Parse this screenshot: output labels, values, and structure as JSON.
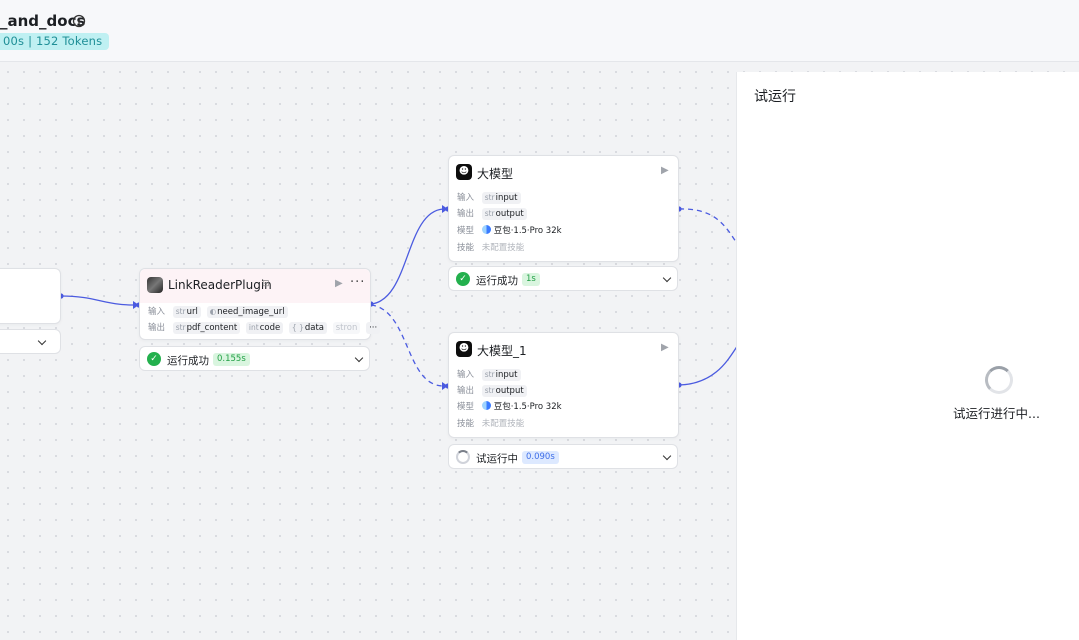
{
  "header": {
    "title": "_and_docs",
    "stats": "00s | 152 Tokens"
  },
  "nodes": {
    "plugin": {
      "title": "LinkReaderPlugin",
      "input_label": "输入",
      "output_label": "输出",
      "inputs": [
        {
          "type": "str",
          "name": "url"
        },
        {
          "type": "◐",
          "name": "need_image_url"
        }
      ],
      "outputs": [
        {
          "type": "str",
          "name": "pdf_content"
        },
        {
          "type": "int",
          "name": "code"
        },
        {
          "type": "{ }",
          "name": "data"
        },
        {
          "type": "",
          "name": "stron"
        }
      ],
      "more": "···",
      "status": {
        "text": "运行成功",
        "duration": "0.155s"
      }
    },
    "llm": {
      "title": "大模型",
      "input_label": "输入",
      "output_label": "输出",
      "model_label": "模型",
      "skill_label": "技能",
      "input": {
        "type": "str",
        "name": "input"
      },
      "output": {
        "type": "str",
        "name": "output"
      },
      "model": "豆包·1.5·Pro 32k",
      "skill": "未配置技能",
      "status": {
        "text": "运行成功",
        "duration": "1s"
      }
    },
    "llm1": {
      "title": "大模型_1",
      "input_label": "输入",
      "output_label": "输出",
      "model_label": "模型",
      "skill_label": "技能",
      "input": {
        "type": "str",
        "name": "input"
      },
      "output": {
        "type": "str",
        "name": "output"
      },
      "model": "豆包·1.5·Pro 32k",
      "skill": "未配置技能",
      "status": {
        "text": "试运行中",
        "duration": "0.090s"
      }
    }
  },
  "panel": {
    "title": "试运行",
    "loading": "试运行进行中..."
  },
  "colors": {
    "edge": "#4b5be0",
    "success": "#23b04d",
    "badge_cyan": "#bff0f2"
  },
  "icons": {
    "info": "info-icon",
    "plugin_logo": "plugin-icon",
    "llm_logo": "llm-logo-icon",
    "play": "play-icon",
    "chevron": "chevron-down-icon",
    "success": "check-circle-icon",
    "running": "spinner-icon"
  }
}
